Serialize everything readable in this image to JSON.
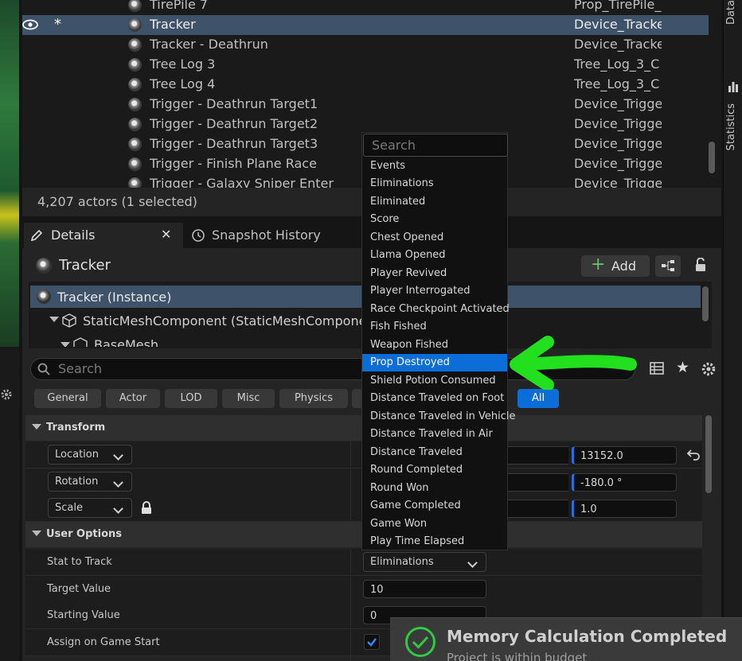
{
  "right_tabs": {
    "data": "Data",
    "statistics": "Statistics"
  },
  "outliner": {
    "rows": [
      {
        "name": "TirePile 7",
        "type": "Prop_TirePile_"
      },
      {
        "name": "Tracker",
        "type": "Device_Tracke",
        "selected": true
      },
      {
        "name": "Tracker - Deathrun",
        "type": "Device_Tracke"
      },
      {
        "name": "Tree Log 3",
        "type": "Tree_Log_3_C"
      },
      {
        "name": "Tree Log 4",
        "type": "Tree_Log_3_C"
      },
      {
        "name": "Trigger - Deathrun Target1",
        "type": "Device_Trigge"
      },
      {
        "name": "Trigger - Deathrun Target2",
        "type": "Device_Trigge"
      },
      {
        "name": "Trigger - Deathrun Target3",
        "type": "Device_Trigge"
      },
      {
        "name": "Trigger - Finish Plane Race",
        "type": "Device_Trigge"
      },
      {
        "name": "Trigger - Galaxy Sniper Enter",
        "type": "Device_Trigge"
      }
    ],
    "actor_count": "4,207 actors (1 selected)"
  },
  "tabs": {
    "details": "Details",
    "snapshot": "Snapshot History"
  },
  "details": {
    "actor_name": "Tracker",
    "add_label": "Add",
    "components": {
      "instance": "Tracker (Instance)",
      "static_mesh": "StaticMeshComponent (StaticMeshCompone",
      "base_mesh": "BaseMesh"
    },
    "search_placeholder": "Search",
    "filters": [
      "General",
      "Actor",
      "LOD",
      "Misc",
      "Physics",
      "",
      "All"
    ],
    "transform": {
      "title": "Transform",
      "location": {
        "label": "Location",
        "z": "13152.0"
      },
      "rotation": {
        "label": "Rotation",
        "z": "-180.0 °"
      },
      "scale": {
        "label": "Scale",
        "z": "1.0"
      }
    },
    "user_options": {
      "title": "User Options",
      "stat_to_track": {
        "label": "Stat to Track",
        "value": "Eliminations"
      },
      "target_value": {
        "label": "Target Value",
        "value": "10"
      },
      "starting_value": {
        "label": "Starting Value",
        "value": "0"
      },
      "assign_on_start": {
        "label": "Assign on Game Start",
        "checked": true
      }
    }
  },
  "menu": {
    "search_placeholder": "Search",
    "items": [
      "Events",
      "Eliminations",
      "Eliminated",
      "Score",
      "Chest Opened",
      "Llama Opened",
      "Player Revived",
      "Player Interrogated",
      "Race Checkpoint Activated",
      "Fish Fished",
      "Weapon Fished",
      "Prop Destroyed",
      "Shield Potion Consumed",
      "Distance Traveled on Foot",
      "Distance Traveled in Vehicle",
      "Distance Traveled in Air",
      "Distance Traveled",
      "Round Completed",
      "Round Won",
      "Game Completed",
      "Game Won",
      "Play Time Elapsed"
    ],
    "highlighted": "Prop Destroyed"
  },
  "toast": {
    "title": "Memory Calculation Completed",
    "subtitle": "Project is within budget"
  },
  "colors": {
    "accent": "#0b6ed8",
    "annotation_arrow": "#22e01e",
    "selection": "#3e5269"
  }
}
